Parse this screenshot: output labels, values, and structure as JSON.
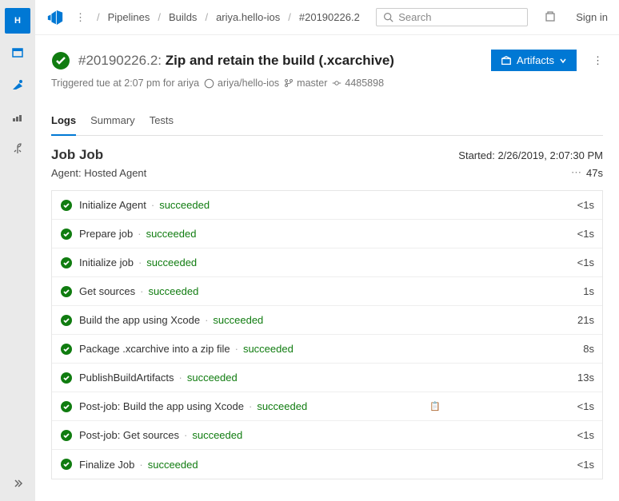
{
  "breadcrumbs": [
    "Pipelines",
    "Builds",
    "ariya.hello-ios",
    "#20190226.2"
  ],
  "search_placeholder": "Search",
  "signin": "Sign in",
  "title_number": "#20190226.2:",
  "title_name": "Zip and retain the build (.xcarchive)",
  "artifacts_label": "Artifacts",
  "trigger": {
    "prefix": "Triggered tue at 2:07 pm for ariya",
    "repo": "ariya/hello-ios",
    "branch": "master",
    "commit": "4485898"
  },
  "tabs": [
    "Logs",
    "Summary",
    "Tests"
  ],
  "active_tab": 0,
  "job": {
    "title": "Job Job",
    "started_label": "Started:",
    "started_time": "2/26/2019, 2:07:30 PM",
    "agent_label": "Agent:",
    "agent_name": "Hosted Agent",
    "duration": "47s"
  },
  "status_succeeded": "succeeded",
  "steps": [
    {
      "name": "Initialize Agent",
      "time": "<1s"
    },
    {
      "name": "Prepare job",
      "time": "<1s"
    },
    {
      "name": "Initialize job",
      "time": "<1s"
    },
    {
      "name": "Get sources",
      "time": "1s"
    },
    {
      "name": "Build the app using Xcode",
      "time": "21s"
    },
    {
      "name": "Package .xcarchive into a zip file",
      "time": "8s"
    },
    {
      "name": "PublishBuildArtifacts",
      "time": "13s"
    },
    {
      "name": "Post-job: Build the app using Xcode",
      "time": "<1s",
      "icon": true
    },
    {
      "name": "Post-job: Get sources",
      "time": "<1s"
    },
    {
      "name": "Finalize Job",
      "time": "<1s"
    }
  ]
}
